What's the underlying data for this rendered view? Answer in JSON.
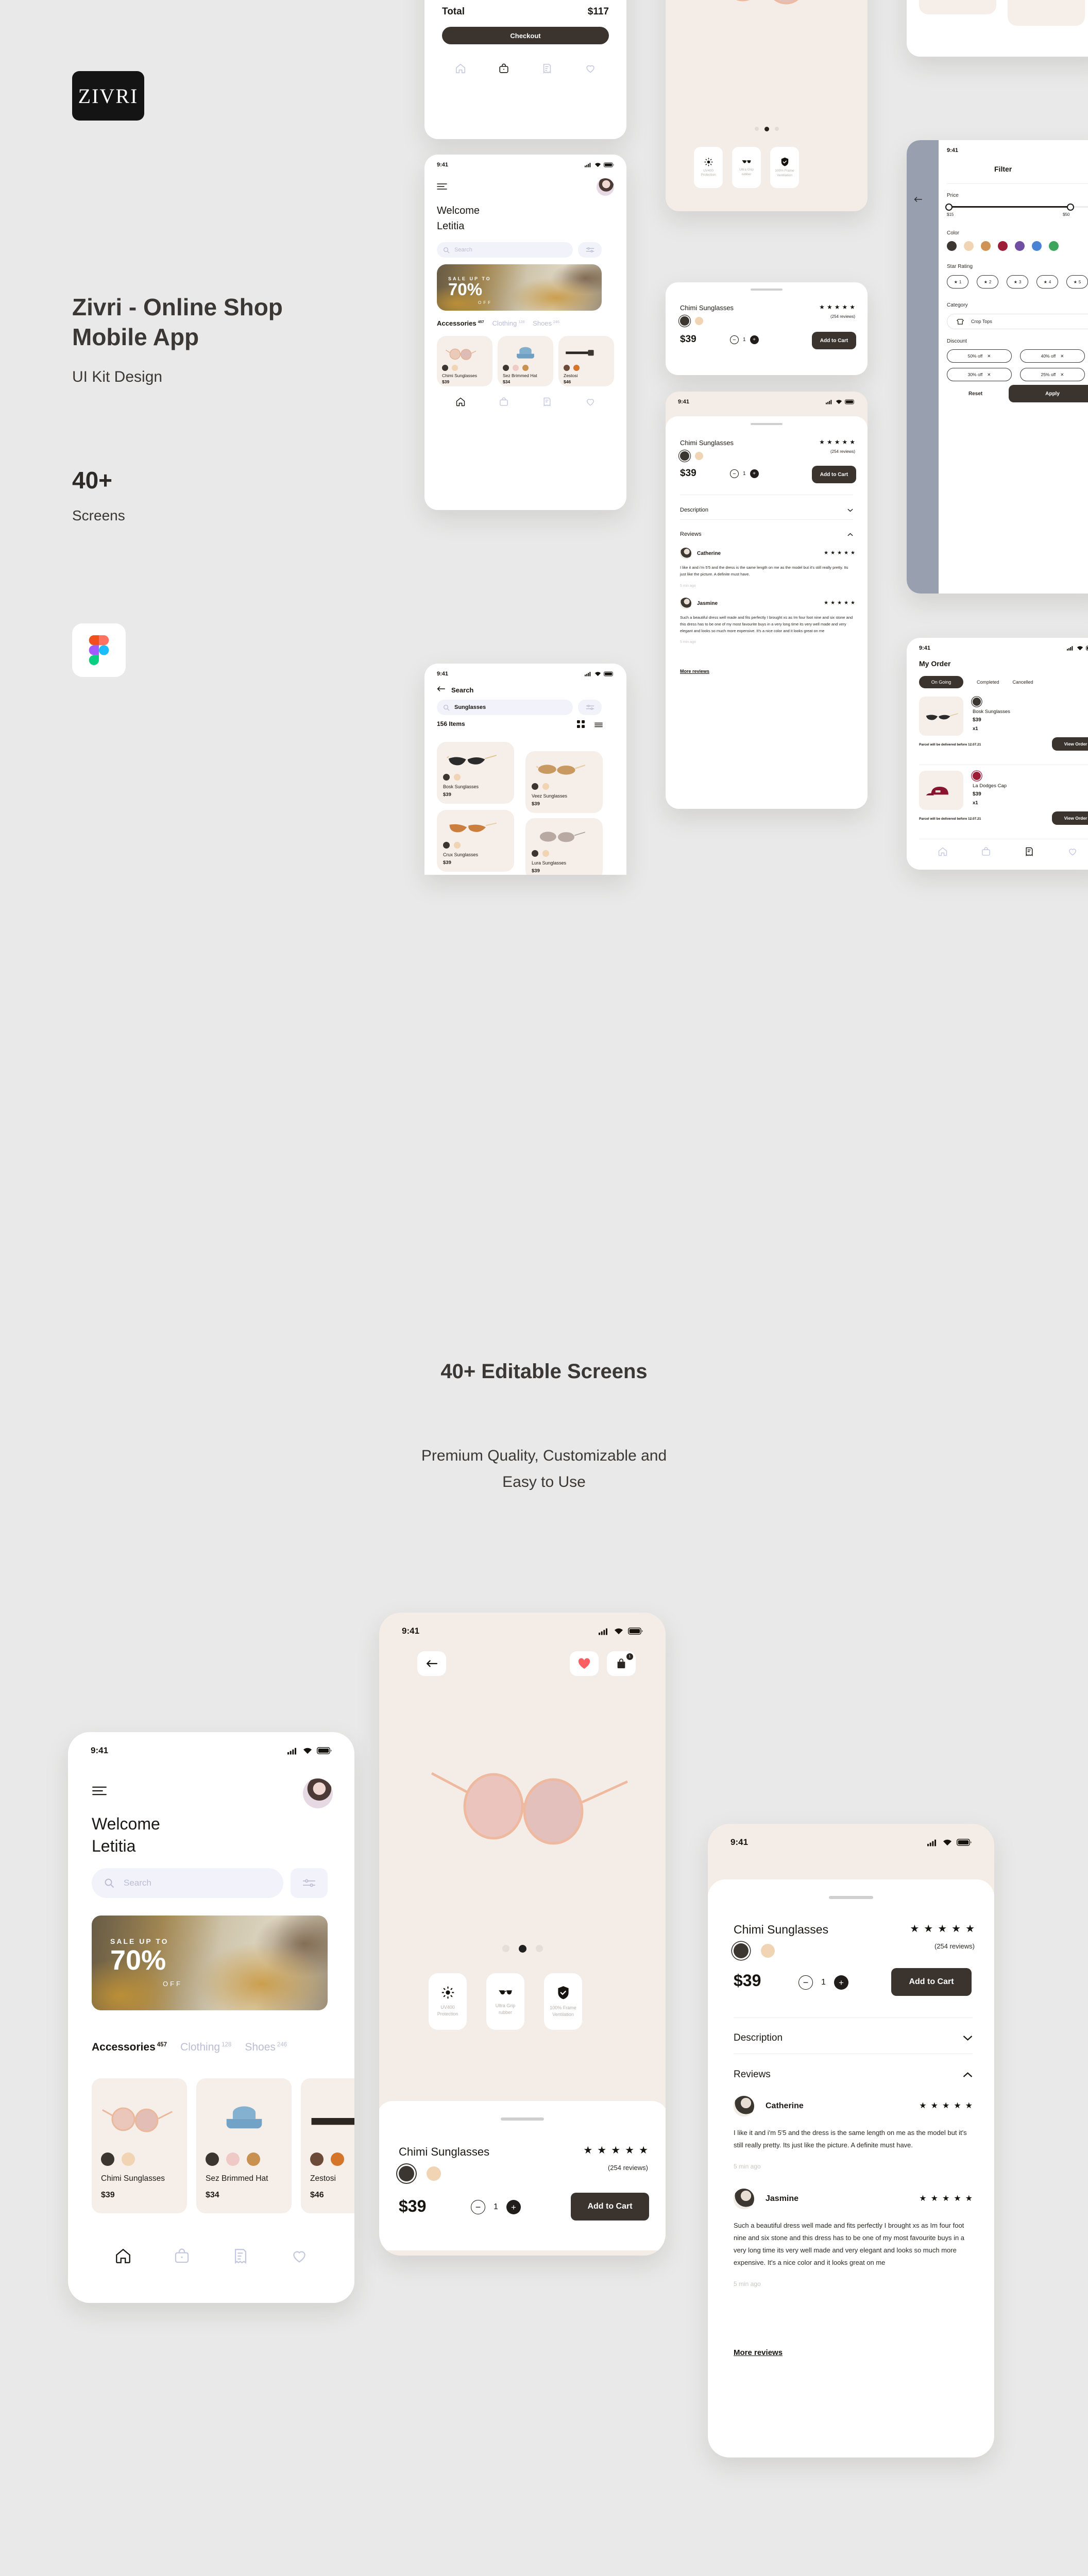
{
  "brand": {
    "logo_text": "ZIVRI",
    "title": "Zivri - Online Shop Mobile App",
    "subtitle": "UI Kit Design",
    "count": "40+",
    "count_label": "Screens",
    "tool_icon": "figma-icon"
  },
  "midsection": {
    "headline": "40+ Editable Screens",
    "sub_line1": "Premium Quality, Customizable and",
    "sub_line2": "Easy to Use"
  },
  "status_bar": {
    "time": "9:41",
    "cellular": "signal-icon",
    "wifi": "wifi-icon",
    "battery": "battery-icon"
  },
  "cart_screen": {
    "total_label": "Total",
    "total_value": "$117",
    "checkout_label": "Checkout"
  },
  "home_screen": {
    "menu_icon": "hamburger-icon",
    "avatar": "user-avatar",
    "welcome_line1": "Welcome",
    "welcome_line2": "Letitia",
    "search_placeholder": "Search",
    "search_icon": "search-icon",
    "filter_icon": "sliders-icon",
    "banner": {
      "small": "SALE UP TO",
      "big": "70%",
      "off": "OFF"
    },
    "categories": [
      {
        "label": "Accessories",
        "count": "457",
        "active": true
      },
      {
        "label": "Clothing",
        "count": "128",
        "active": false
      },
      {
        "label": "Shoes",
        "count": "246",
        "active": false
      }
    ],
    "products": [
      {
        "name": "Chimi Sunglasses",
        "price": "$39",
        "colors": [
          "#3c3631",
          "#f0d4b4"
        ]
      },
      {
        "name": "Sez Brimmed Hat",
        "price": "$34",
        "colors": [
          "#3c3631",
          "#efc9c6",
          "#c9914f"
        ]
      },
      {
        "name": "Zestosi",
        "price": "$46",
        "colors": [
          "#6b4a3a",
          "#d4752a"
        ]
      }
    ],
    "nav": [
      "home-icon",
      "bag-icon",
      "receipt-icon",
      "heart-icon"
    ],
    "nav_active_index": 0
  },
  "search_screen": {
    "back_icon": "arrow-left-icon",
    "title": "Search",
    "query": "Sunglasses",
    "search_icon": "search-icon",
    "filter_icon": "sliders-icon",
    "items_count": "156 Items",
    "grid_icon": "grid-view-icon",
    "list_icon": "list-view-icon",
    "results": [
      {
        "name": "Bosk Sunglasses",
        "price": "$39",
        "colors": [
          "#3c3631",
          "#f0d4b4"
        ]
      },
      {
        "name": "Veez Sunglasses",
        "price": "$39",
        "colors": [
          "#3c3631",
          "#f0d4b4"
        ]
      },
      {
        "name": "Crux Sunglasses",
        "price": "$39",
        "colors": [
          "#3c3631",
          "#f0d4b4"
        ]
      },
      {
        "name": "Lura Sunglasses",
        "price": "$39",
        "colors": [
          "#3c3631",
          "#f0d4b4"
        ]
      }
    ]
  },
  "product_screen": {
    "back_icon": "arrow-left-icon",
    "favorite_icon": "heart-filled-icon",
    "cart_icon": "bag-icon",
    "cart_badge": "1",
    "carousel_dots": 3,
    "carousel_active": 1,
    "features": [
      {
        "icon": "sun-icon",
        "line1": "UV400",
        "line2": "Protection"
      },
      {
        "icon": "sunglasses-icon",
        "line1": "Ultra Grip",
        "line2": "rubber"
      },
      {
        "icon": "shield-check-icon",
        "line1": "100% Frame",
        "line2": "Ventilation"
      }
    ],
    "name": "Chimi Sunglasses",
    "rating_stars": 5,
    "reviews_label": "(254 reviews)",
    "colors": [
      "#3c3631",
      "#f0d4b4"
    ],
    "selected_color_index": 0,
    "price": "$39",
    "minus_icon": "minus-icon",
    "plus_icon": "plus-icon",
    "quantity": "1",
    "add_to_cart_label": "Add to Cart",
    "description_label": "Description",
    "description_chevron": "chevron-down-icon",
    "reviews_label_section": "Reviews",
    "reviews_chevron": "chevron-up-icon",
    "reviews": [
      {
        "author": "Catherine",
        "stars": 5,
        "body": "I like it and i'm 5'5 and the dress is the same length on me as the model but it's still really pretty. Its just like the picture. A definite must have.",
        "time": "5 min ago"
      },
      {
        "author": "Jasmine",
        "stars": 5,
        "body": "Such a beautiful dress well made and fits perfectly I brought xs as Im four foot nine and six stone and this dress has to be one of my most favourite buys in a very long time its very well made and very elegant and looks so much more expensive. It's a nice color and it looks great on me",
        "time": "5 min ago"
      }
    ],
    "more_reviews_label": "More reviews"
  },
  "filter_screen": {
    "back_icon": "arrow-left-icon",
    "title": "Filter",
    "price_label": "Price",
    "price_min": "$15",
    "price_max": "$50",
    "color_label": "Color",
    "colors": [
      "#3c3631",
      "#f0d4b4",
      "#cf9455",
      "#9e1d36",
      "#6e4fa3",
      "#4a82d6",
      "#3ba55c"
    ],
    "star_label": "Star Rating",
    "star_options": [
      "1",
      "2",
      "3",
      "4",
      "5"
    ],
    "category_label": "Category",
    "category_icon": "croptop-icon",
    "category_value": "Crop Tops",
    "discount_label": "Discount",
    "discounts": [
      "50% off",
      "40% off",
      "30% off",
      "25% off"
    ],
    "remove_icon": "close-icon",
    "reset_label": "Reset",
    "apply_label": "Apply"
  },
  "order_screen": {
    "title": "My Order",
    "tabs": [
      "On Going",
      "Completed",
      "Cancelled"
    ],
    "active_tab": 0,
    "orders": [
      {
        "name": "Bosk Sunglasses",
        "price": "$39",
        "qty": "x1",
        "color": "#3c3631",
        "delivery": "Parcel will be delivered before 12.07.21",
        "action": "View Order"
      },
      {
        "name": "La Dodges Cap",
        "price": "$39",
        "qty": "x1",
        "color": "#9e1d36",
        "delivery": "Parcel will be delivered before 12.07.21",
        "action": "View Order"
      }
    ],
    "nav": [
      "home-icon",
      "bag-icon",
      "receipt-icon",
      "heart-icon"
    ],
    "nav_active_index": 2
  },
  "colors": {
    "page_bg": "#e9e9e9",
    "dark": "#3a332e",
    "card_bg": "#f6eee8",
    "accent_lavender": "#f2f2fa",
    "muted_text": "#b9bcd4"
  }
}
